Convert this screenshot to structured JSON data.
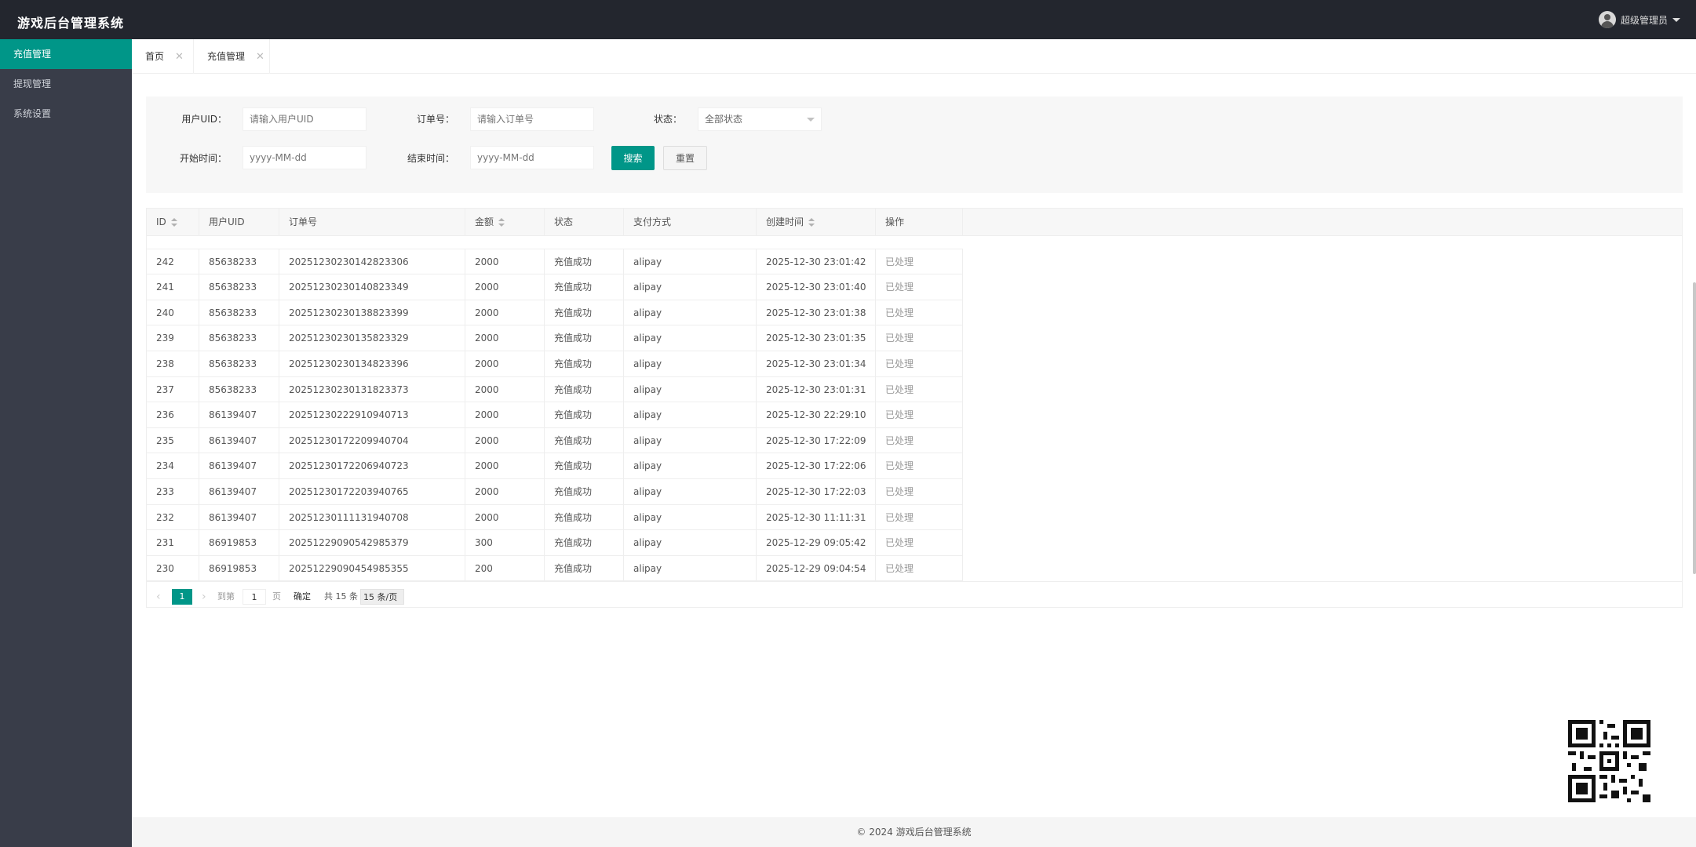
{
  "app": {
    "title": "游戏后台管理系统",
    "user": "超级管理员"
  },
  "sidebar": {
    "items": [
      {
        "label": "充值管理"
      },
      {
        "label": "提现管理"
      },
      {
        "label": "系统设置"
      }
    ]
  },
  "tabs": [
    {
      "label": "首页"
    },
    {
      "label": "充值管理"
    }
  ],
  "search": {
    "uid_label": "用户UID：",
    "uid_placeholder": "请输入用户UID",
    "order_label": "订单号：",
    "order_placeholder": "请输入订单号",
    "status_label": "状态：",
    "status_value": "全部状态",
    "start_label": "开始时间：",
    "start_placeholder": "yyyy-MM-dd",
    "end_label": "结束时间：",
    "end_placeholder": "yyyy-MM-dd",
    "search_button": "搜索",
    "reset_button": "重置"
  },
  "table": {
    "headers": [
      "ID",
      "用户UID",
      "订单号",
      "金额",
      "状态",
      "支付方式",
      "创建时间",
      "操作"
    ],
    "rows": [
      [
        "242",
        "85638233",
        "20251230230142823306",
        "2000",
        "充值成功",
        "alipay",
        "2025-12-30 23:01:42",
        "已处理"
      ],
      [
        "241",
        "85638233",
        "20251230230140823349",
        "2000",
        "充值成功",
        "alipay",
        "2025-12-30 23:01:40",
        "已处理"
      ],
      [
        "240",
        "85638233",
        "20251230230138823399",
        "2000",
        "充值成功",
        "alipay",
        "2025-12-30 23:01:38",
        "已处理"
      ],
      [
        "239",
        "85638233",
        "20251230230135823329",
        "2000",
        "充值成功",
        "alipay",
        "2025-12-30 23:01:35",
        "已处理"
      ],
      [
        "238",
        "85638233",
        "20251230230134823396",
        "2000",
        "充值成功",
        "alipay",
        "2025-12-30 23:01:34",
        "已处理"
      ],
      [
        "237",
        "85638233",
        "20251230230131823373",
        "2000",
        "充值成功",
        "alipay",
        "2025-12-30 23:01:31",
        "已处理"
      ],
      [
        "236",
        "86139407",
        "20251230222910940713",
        "2000",
        "充值成功",
        "alipay",
        "2025-12-30 22:29:10",
        "已处理"
      ],
      [
        "235",
        "86139407",
        "20251230172209940704",
        "2000",
        "充值成功",
        "alipay",
        "2025-12-30 17:22:09",
        "已处理"
      ],
      [
        "234",
        "86139407",
        "20251230172206940723",
        "2000",
        "充值成功",
        "alipay",
        "2025-12-30 17:22:06",
        "已处理"
      ],
      [
        "233",
        "86139407",
        "20251230172203940765",
        "2000",
        "充值成功",
        "alipay",
        "2025-12-30 17:22:03",
        "已处理"
      ],
      [
        "232",
        "86139407",
        "20251230111131940708",
        "2000",
        "充值成功",
        "alipay",
        "2025-12-30 11:11:31",
        "已处理"
      ],
      [
        "231",
        "86919853",
        "20251229090542985379",
        "300",
        "充值成功",
        "alipay",
        "2025-12-29 09:05:42",
        "已处理"
      ],
      [
        "230",
        "86919853",
        "20251229090454985355",
        "200",
        "充值成功",
        "alipay",
        "2025-12-29 09:04:54",
        "已处理"
      ]
    ]
  },
  "pager": {
    "current": "1",
    "goto": "到第",
    "page_input": "1",
    "unit": "页",
    "ok": "确定",
    "total": "共 15 条",
    "page_size": "15 条/页"
  },
  "footer": "© 2024 游戏后台管理系统",
  "colors": {
    "accent": "#009688",
    "topbar": "#23262e",
    "sidebar": "#393d49"
  }
}
